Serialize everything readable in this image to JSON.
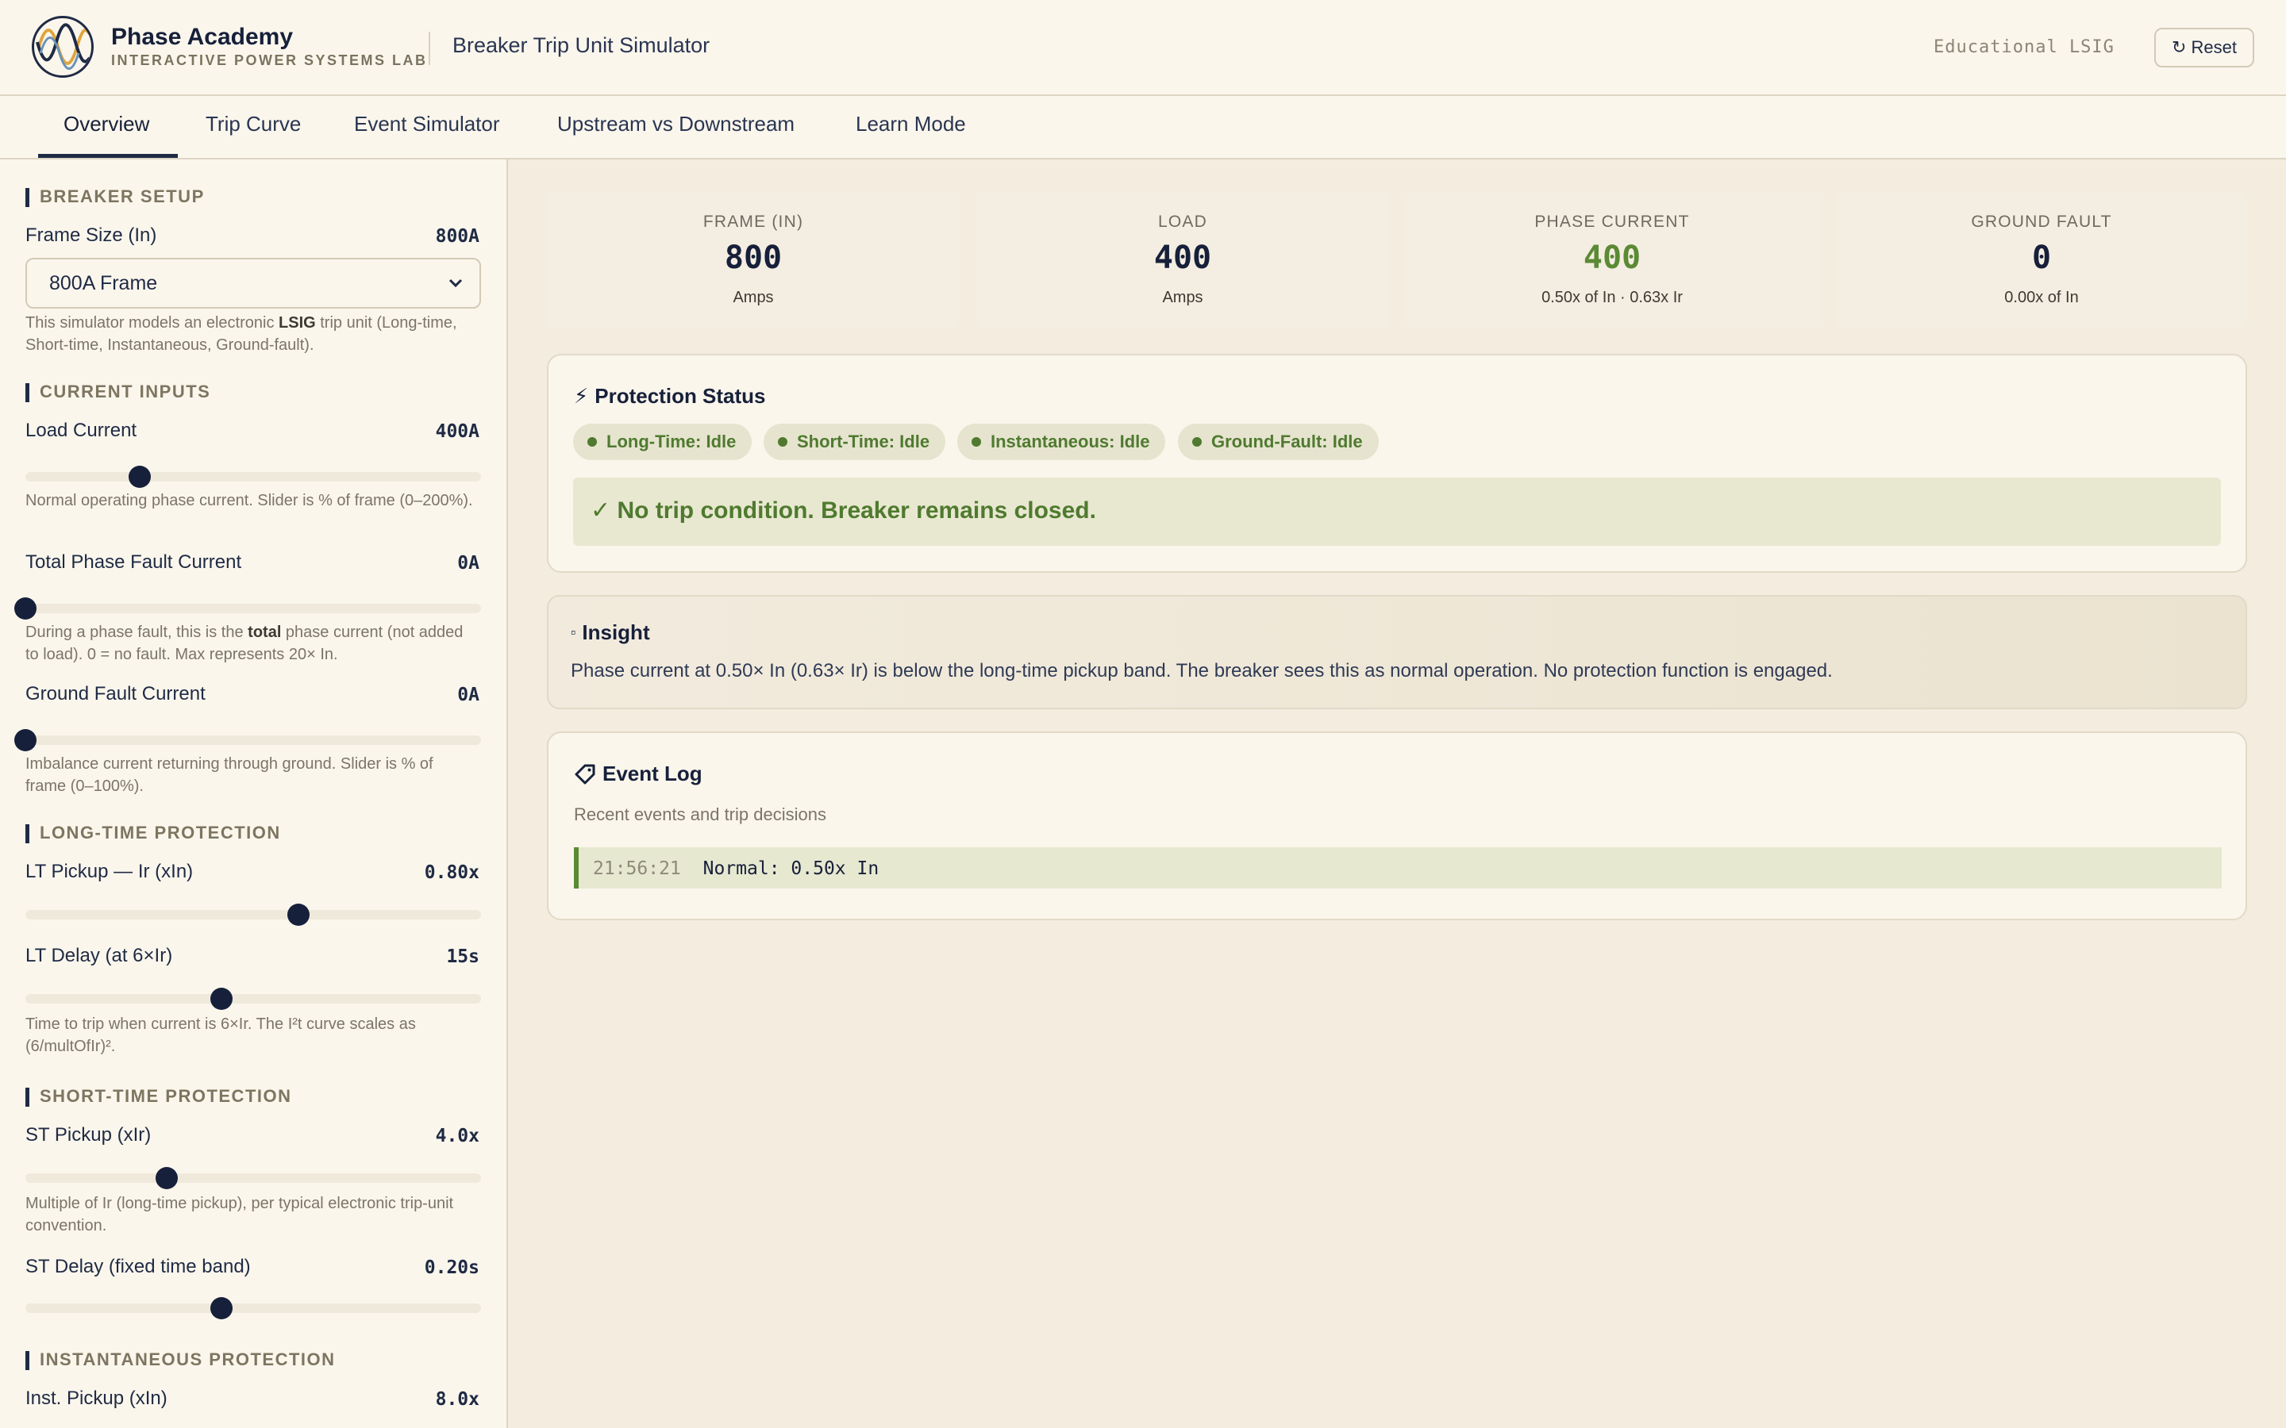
{
  "header": {
    "brand_name": "Phase Academy",
    "brand_sub": "INTERACTIVE POWER SYSTEMS LAB",
    "app_title": "Breaker Trip Unit Simulator",
    "edu_label": "Educational LSIG",
    "reset_label": "Reset",
    "reset_icon": "↻"
  },
  "tabs": [
    {
      "label": "Overview",
      "active": true
    },
    {
      "label": "Trip Curve",
      "active": false
    },
    {
      "label": "Event Simulator",
      "active": false
    },
    {
      "label": "Upstream vs Downstream",
      "active": false
    },
    {
      "label": "Learn Mode",
      "active": false
    }
  ],
  "sidebar": {
    "breaker_setup": {
      "title": "BREAKER SETUP",
      "frame_label": "Frame Size (In)",
      "frame_value": "800A",
      "frame_select": "800A Frame",
      "help_pre": "This simulator models an electronic ",
      "help_bold": "LSIG",
      "help_post": " trip unit (Long-time, Short-time, Instantaneous, Ground-fault)."
    },
    "current_inputs": {
      "title": "CURRENT INPUTS",
      "load_label": "Load Current",
      "load_value": "400A",
      "load_slider_percent": 25,
      "load_help": "Normal operating phase current. Slider is % of frame (0–200%).",
      "fault_label": "Total Phase Fault Current",
      "fault_value": "0A",
      "fault_slider_percent": 0,
      "fault_help_pre": "During a phase fault, this is the ",
      "fault_help_bold": "total",
      "fault_help_post": " phase current (not added to load). 0 = no fault. Max represents 20× In.",
      "ground_label": "Ground Fault Current",
      "ground_value": "0A",
      "ground_slider_percent": 0,
      "ground_help": "Imbalance current returning through ground. Slider is % of frame (0–100%)."
    },
    "long_time": {
      "title": "LONG-TIME PROTECTION",
      "pickup_label": "LT Pickup — Ir (xIn)",
      "pickup_value": "0.80x",
      "pickup_slider_percent": 60,
      "delay_label": "LT Delay (at 6×Ir)",
      "delay_value": "15s",
      "delay_slider_percent": 43,
      "delay_help": "Time to trip when current is 6×Ir. The I²t curve scales as (6/multOfIr)²."
    },
    "short_time": {
      "title": "SHORT-TIME PROTECTION",
      "pickup_label": "ST Pickup (xIr)",
      "pickup_value": "4.0x",
      "pickup_slider_percent": 31,
      "pickup_help": "Multiple of Ir (long-time pickup), per typical electronic trip-unit convention.",
      "delay_label": "ST Delay (fixed time band)",
      "delay_value": "0.20s",
      "delay_slider_percent": 43
    },
    "instantaneous": {
      "title": "INSTANTANEOUS PROTECTION",
      "pickup_label": "Inst. Pickup (xIn)",
      "pickup_value": "8.0x"
    }
  },
  "stats": [
    {
      "label": "FRAME (IN)",
      "value": "800",
      "sub": "Amps",
      "color": "#17203a"
    },
    {
      "label": "LOAD",
      "value": "400",
      "sub": "Amps",
      "color": "#17203a"
    },
    {
      "label": "PHASE CURRENT",
      "value": "400",
      "sub": "0.50x of In · 0.63x Ir",
      "color": "#5b8a34"
    },
    {
      "label": "GROUND FAULT",
      "value": "0",
      "sub": "0.00x of In",
      "color": "#17203a"
    }
  ],
  "protection": {
    "icon": "⚡",
    "title": "Protection Status",
    "pills": [
      "Long-Time: Idle",
      "Short-Time: Idle",
      "Instantaneous: Idle",
      "Ground-Fault: Idle"
    ],
    "banner": "✓ No trip condition. Breaker remains closed."
  },
  "insight": {
    "icon": "▫",
    "title": "Insight",
    "text": "Phase current at 0.50× In (0.63× Ir) is below the long-time pickup band. The breaker sees this as normal operation. No protection function is engaged."
  },
  "event_log": {
    "title": "Event Log",
    "subtitle": "Recent events and trip decisions",
    "entries": [
      {
        "time": "21:56:21",
        "message": "Normal: 0.50x In"
      }
    ]
  }
}
